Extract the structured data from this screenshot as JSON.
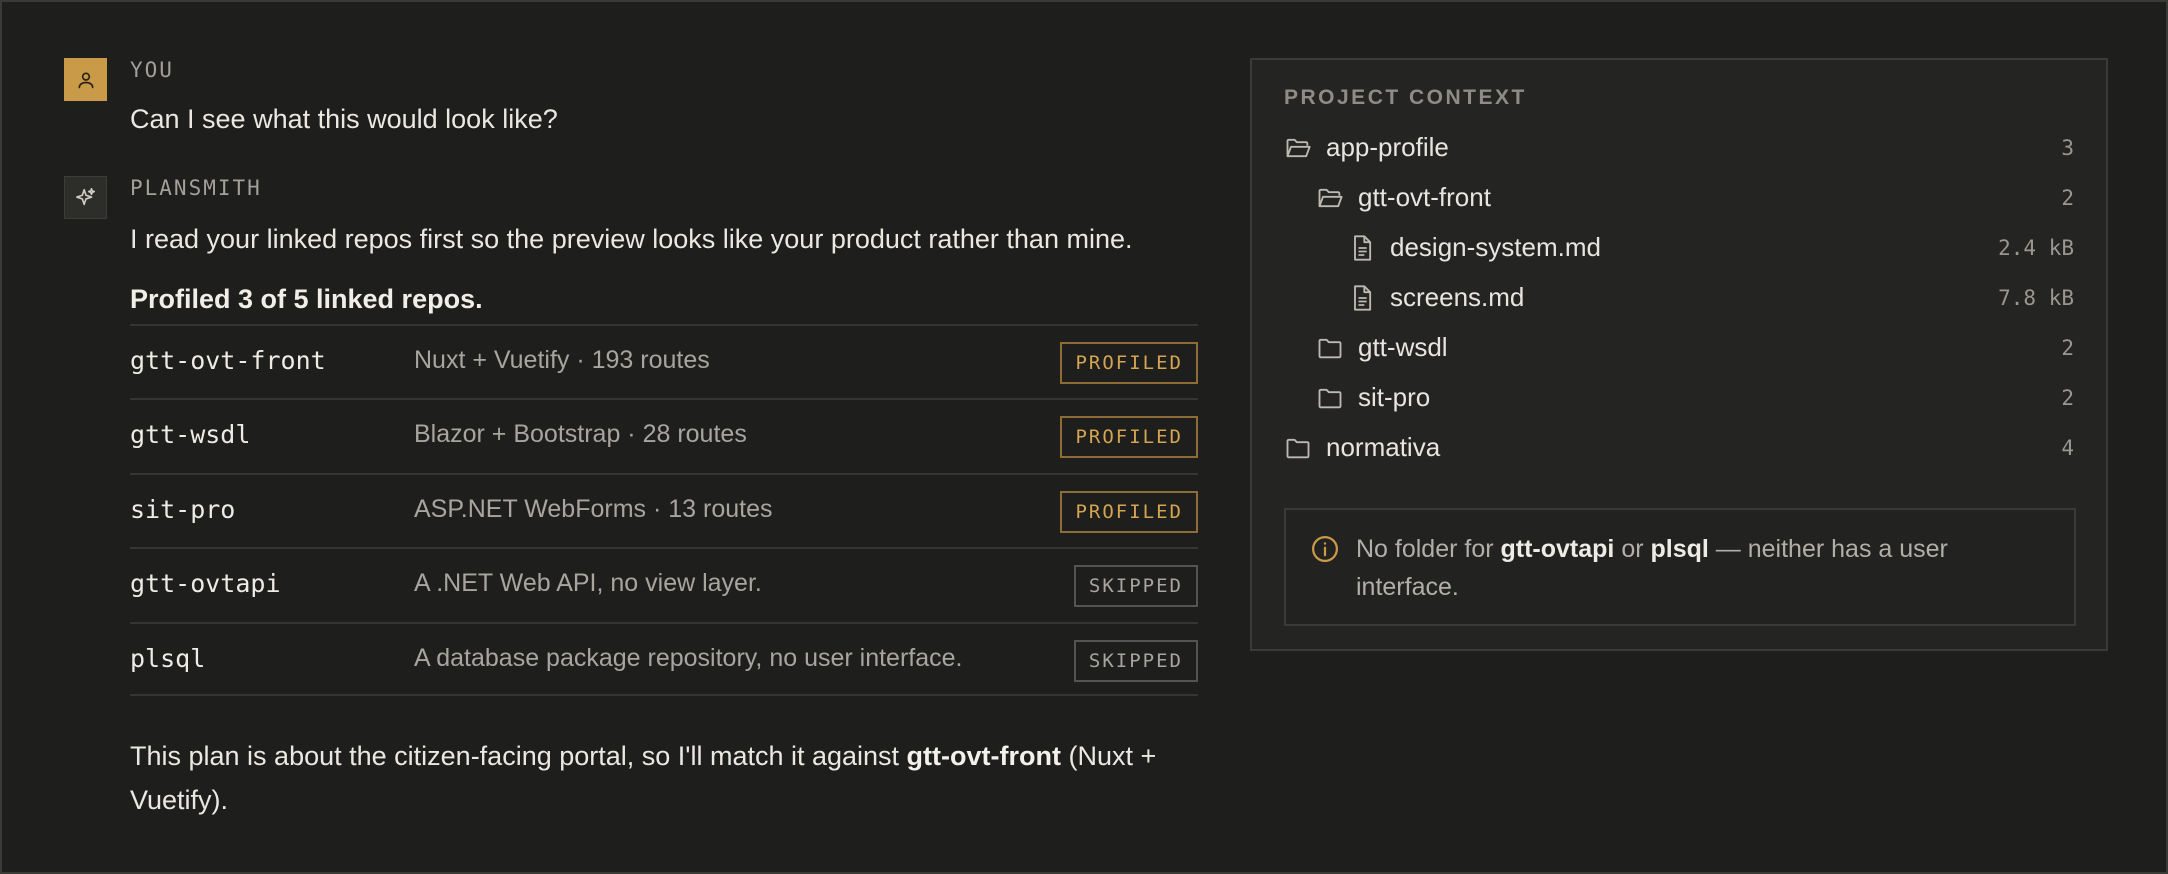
{
  "conversation": {
    "user": {
      "author": "YOU",
      "text": "Can I see what this would look like?"
    },
    "assistant": {
      "author": "PLANSMITH",
      "intro": "I read your linked repos first so the preview looks like your product rather than mine.",
      "summary": "Profiled 3 of 5 linked repos.",
      "repos": [
        {
          "name": "gtt-ovt-front",
          "description": "Nuxt + Vuetify · 193 routes",
          "status": "PROFILED"
        },
        {
          "name": "gtt-wsdl",
          "description": "Blazor + Bootstrap · 28 routes",
          "status": "PROFILED"
        },
        {
          "name": "sit-pro",
          "description": "ASP.NET WebForms · 13 routes",
          "status": "PROFILED"
        },
        {
          "name": "gtt-ovtapi",
          "description": "A .NET Web API, no view layer.",
          "status": "SKIPPED"
        },
        {
          "name": "plsql",
          "description": "A database package repository, no user interface.",
          "status": "SKIPPED"
        }
      ],
      "closing": {
        "part1": "This plan is about the citizen-facing portal, so I'll match it against ",
        "highlight": "gtt-ovt-front",
        "part2": " (Nuxt + Vuetify)."
      }
    }
  },
  "project_context": {
    "title": "PROJECT CONTEXT",
    "tree": [
      {
        "label": "app-profile",
        "meta": "3",
        "icon": "folder-open-icon"
      },
      {
        "label": "gtt-ovt-front",
        "meta": "2",
        "icon": "folder-open-icon"
      },
      {
        "label": "design-system.md",
        "meta": "2.4 kB",
        "icon": "file-icon"
      },
      {
        "label": "screens.md",
        "meta": "7.8 kB",
        "icon": "file-icon"
      },
      {
        "label": "gtt-wsdl",
        "meta": "2",
        "icon": "folder-icon"
      },
      {
        "label": "sit-pro",
        "meta": "2",
        "icon": "folder-icon"
      },
      {
        "label": "normativa",
        "meta": "4",
        "icon": "folder-icon"
      }
    ],
    "notice": {
      "prefix": "No folder for ",
      "repo1": "gtt-ovtapi",
      "middle": " or ",
      "repo2": "plsql",
      "suffix": " — neither has a user interface."
    }
  },
  "colors": {
    "accent": "#c99a47",
    "background": "#1e1e1c",
    "panel": "#242422"
  }
}
